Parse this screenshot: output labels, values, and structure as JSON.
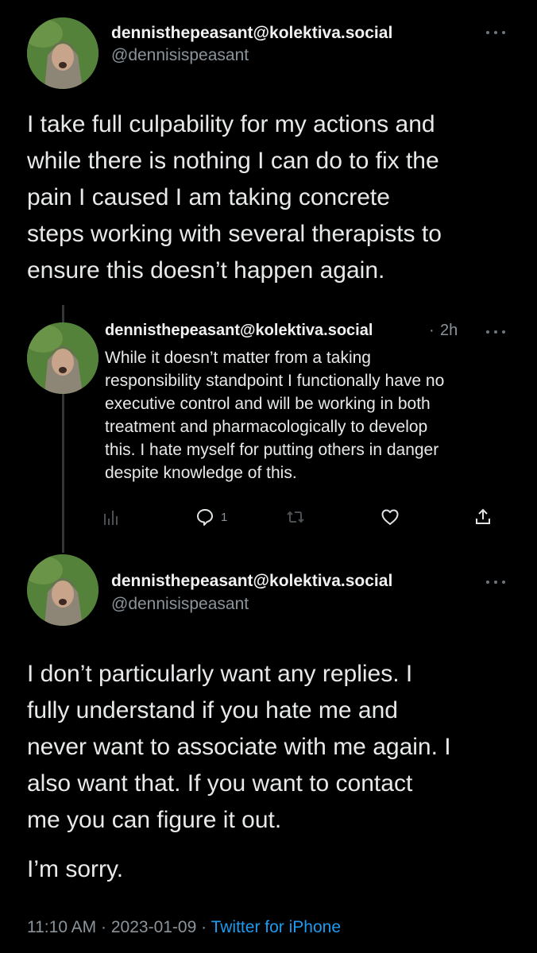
{
  "tweet1": {
    "display_name": "dennisthepeasant@kolektiva.social",
    "handle": "@dennisispeasant",
    "text": "I take full culpability for my actions and\nwhile there is nothing I can do to fix the\npain I caused I am taking concrete\nsteps working with several therapists to\nensure this doesn’t happen again."
  },
  "reply": {
    "display_name": "dennisthepeasant@kolektiva.social",
    "time_sep": "·",
    "time": "2h",
    "text": "While it doesn’t matter from a taking\nresponsibility standpoint I functionally have no\nexecutive control and will be working in both\ntreatment and pharmacologically to develop\nthis. I hate myself for putting others in danger\ndespite knowledge of this.",
    "actions": {
      "analytics_icon": "bar-chart-icon",
      "reply_icon": "speech-bubble-icon",
      "reply_count": "1",
      "retweet_icon": "retweet-icon",
      "like_icon": "heart-icon",
      "share_icon": "share-icon"
    }
  },
  "tweet2": {
    "display_name": "dennisthepeasant@kolektiva.social",
    "handle": "@dennisispeasant",
    "text": "I don’t particularly want any replies. I\nfully understand if you hate me and\nnever want to associate with me again. I\nalso want that. If you want to contact\nme you can figure it out.",
    "text2": "I’m sorry.",
    "time": "11:10 AM",
    "sep1": "·",
    "date": "2023-01-09",
    "sep2": "·",
    "client": "Twitter for iPhone"
  },
  "colors": {
    "background": "#000000",
    "text": "#e7e9ea",
    "muted": "#8b949b",
    "link": "#1d9bf0"
  }
}
